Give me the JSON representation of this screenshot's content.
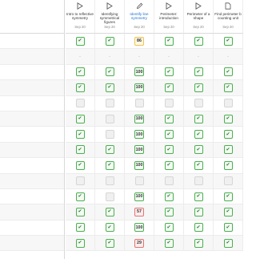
{
  "columns": [
    {
      "icon": "play-icon",
      "title": "Intro to reflective symmetry",
      "date": "Sep 20",
      "highlight": false
    },
    {
      "icon": "play-icon",
      "title": "Identifying symmetrical figures",
      "date": "Sep 20",
      "highlight": false
    },
    {
      "icon": "pencil-icon",
      "title": "Identify line symmetry",
      "date": "Sep 20",
      "highlight": true
    },
    {
      "icon": "play-icon",
      "title": "Perimeter: introduction",
      "date": "Sep 20",
      "highlight": false
    },
    {
      "icon": "play-icon",
      "title": "Perimeter of a shape",
      "date": "Sep 20",
      "highlight": false
    },
    {
      "icon": "doc-icon",
      "title": "Find perimeter b counting unit",
      "date": "Sep 20",
      "highlight": false
    }
  ],
  "rows": [
    [
      "check",
      "check",
      "86",
      "check",
      "check",
      "check"
    ],
    [
      "dash",
      "dash",
      "dash",
      "dash",
      "dash",
      "dash"
    ],
    [
      "check",
      "check",
      "100",
      "check",
      "check",
      "check"
    ],
    [
      "check",
      "check",
      "100",
      "check",
      "check",
      "check"
    ],
    [
      "empty",
      "empty",
      "empty",
      "empty",
      "empty",
      "empty"
    ],
    [
      "check",
      "empty",
      "100",
      "check",
      "check",
      "check"
    ],
    [
      "check",
      "empty",
      "100",
      "check",
      "check",
      "check"
    ],
    [
      "check",
      "check",
      "100",
      "check",
      "check",
      "check"
    ],
    [
      "check",
      "check",
      "100",
      "check",
      "check",
      "check"
    ],
    [
      "empty",
      "empty",
      "empty",
      "empty",
      "empty",
      "empty"
    ],
    [
      "check",
      "empty",
      "100",
      "check",
      "check",
      "check"
    ],
    [
      "check",
      "check",
      "57",
      "check",
      "check",
      "check"
    ],
    [
      "check",
      "check",
      "100",
      "check",
      "check",
      "check"
    ],
    [
      "check",
      "check",
      "29",
      "check",
      "check",
      "check"
    ]
  ]
}
